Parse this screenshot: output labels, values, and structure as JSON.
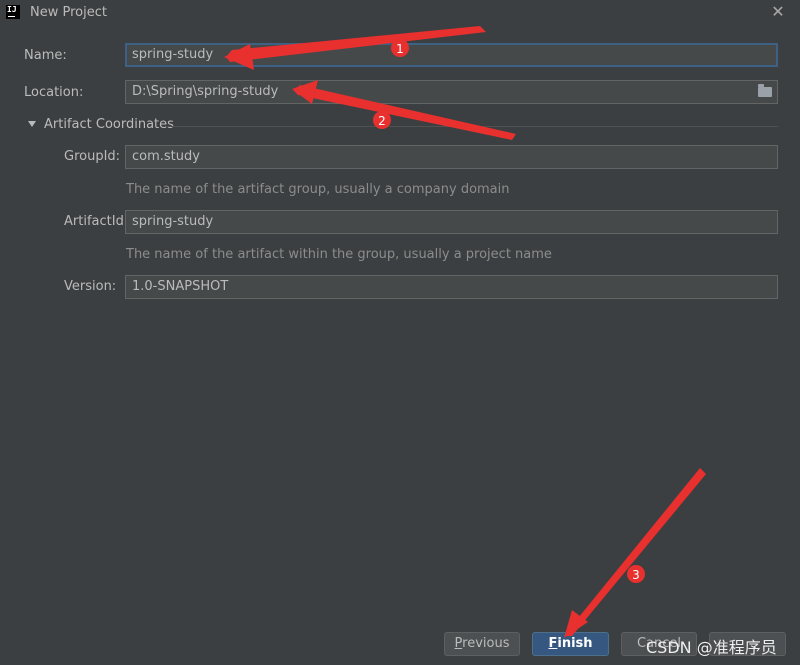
{
  "window": {
    "title": "New Project",
    "app_icon_text": "IJ",
    "close_glyph": "✕"
  },
  "form": {
    "name": {
      "label": "Name:",
      "value": "spring-study"
    },
    "location": {
      "label": "Location:",
      "value": "D:\\Spring\\spring-study",
      "icon": "folder-icon"
    },
    "section_title": "Artifact Coordinates",
    "group_id": {
      "label": "GroupId:",
      "value": "com.study",
      "hint": "The name of the artifact group, usually a company domain"
    },
    "artifact_id": {
      "label": "ArtifactId:",
      "value": "spring-study",
      "hint": "The name of the artifact within the group, usually a project name"
    },
    "version": {
      "label": "Version:",
      "value": "1.0-SNAPSHOT"
    }
  },
  "buttons": {
    "previous": {
      "mnemonic": "P",
      "rest": "revious"
    },
    "finish": {
      "mnemonic": "F",
      "rest": "inish"
    },
    "cancel": {
      "label": "Cancel"
    }
  },
  "annotations": {
    "markers": [
      "1",
      "2",
      "3"
    ],
    "color": "#e8302e"
  },
  "watermark": "CSDN @准程序员",
  "colors": {
    "background": "#3c3f41",
    "field_background": "#45494a",
    "focus_border": "#3d6185",
    "primary_button": "#365880"
  }
}
